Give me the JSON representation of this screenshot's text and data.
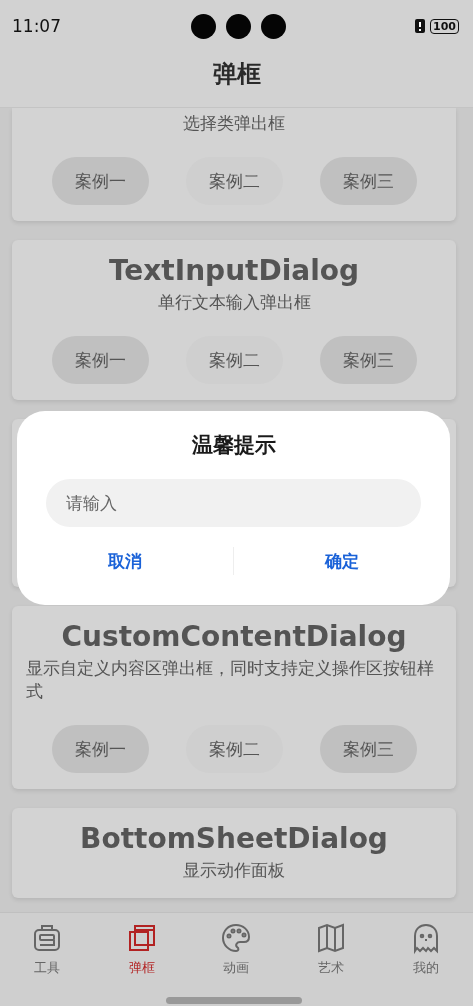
{
  "status_bar": {
    "time": "11:07",
    "battery": "100"
  },
  "header": {
    "title": "弹框"
  },
  "cards": [
    {
      "subtitle": "选择类弹出框",
      "buttons": [
        {
          "label": "案例一",
          "kind": "filled"
        },
        {
          "label": "案例二",
          "kind": "light"
        },
        {
          "label": "案例三",
          "kind": "filled"
        }
      ]
    },
    {
      "title": "TextInputDialog",
      "subtitle": "单行文本输入弹出框",
      "buttons": [
        {
          "label": "案例一",
          "kind": "filled"
        },
        {
          "label": "案例二",
          "kind": "light"
        },
        {
          "label": "案例三",
          "kind": "filled"
        }
      ]
    },
    {
      "kind": "hidden"
    },
    {
      "title": "CustomContentDialog",
      "subtitle": "显示自定义内容区弹出框，同时支持定义操作区按钮样式",
      "buttons": [
        {
          "label": "案例一",
          "kind": "filled"
        },
        {
          "label": "案例二",
          "kind": "light"
        },
        {
          "label": "案例三",
          "kind": "filled"
        }
      ]
    },
    {
      "title": "BottomSheetDialog",
      "subtitle": "显示动作面板"
    }
  ],
  "dialog": {
    "title": "温馨提示",
    "input": {
      "placeholder": "请输入"
    },
    "actions": [
      "取消",
      "确定"
    ]
  },
  "tab_bar": [
    {
      "label": "工具",
      "selected": false
    },
    {
      "label": "弹框",
      "selected": true
    },
    {
      "label": "动画",
      "selected": false
    },
    {
      "label": "艺术",
      "selected": false
    },
    {
      "label": "我的",
      "selected": false
    }
  ]
}
